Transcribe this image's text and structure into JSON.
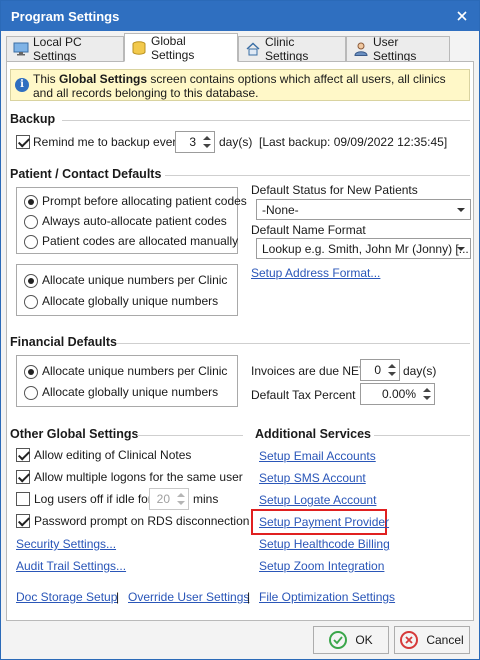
{
  "window": {
    "title": "Program Settings"
  },
  "tabs": [
    {
      "label": "Local PC Settings",
      "icon": "monitor-icon"
    },
    {
      "label": "Global Settings",
      "icon": "database-icon",
      "active": true
    },
    {
      "label": "Clinic Settings",
      "icon": "house-icon"
    },
    {
      "label": "User Settings",
      "icon": "user-icon"
    }
  ],
  "info": {
    "prefix": "This ",
    "bold": "Global Settings",
    "suffix": " screen contains options which affect all users, all clinics and all records belonging to this database."
  },
  "backup": {
    "heading": "Backup",
    "remind_label": "Remind me to backup every",
    "remind_checked": true,
    "days_value": "3",
    "days_unit": "day(s)",
    "last_backup": "[Last backup: 09/09/2022 12:35:45]"
  },
  "patient": {
    "heading": "Patient / Contact Defaults",
    "code_options": [
      {
        "label": "Prompt before allocating patient codes",
        "selected": true
      },
      {
        "label": "Always auto-allocate patient codes",
        "selected": false
      },
      {
        "label": "Patient codes are allocated manually",
        "selected": false
      }
    ],
    "number_options": [
      {
        "label": "Allocate unique numbers per Clinic",
        "selected": true
      },
      {
        "label": "Allocate globally unique numbers",
        "selected": false
      }
    ],
    "default_status_label": "Default Status for New Patients",
    "default_status_value": "-None-",
    "name_format_label": "Default Name Format",
    "name_format_value": "Lookup e.g. Smith, John Mr (Jonny) [...",
    "address_link": "Setup Address Format..."
  },
  "financial": {
    "heading": "Financial Defaults",
    "number_options": [
      {
        "label": "Allocate unique numbers per Clinic",
        "selected": true
      },
      {
        "label": "Allocate globally unique numbers",
        "selected": false
      }
    ],
    "invoices_label": "Invoices are due NET",
    "invoices_value": "0",
    "invoices_unit": "day(s)",
    "tax_label": "Default Tax Percent",
    "tax_value": "0.00%"
  },
  "other": {
    "heading": "Other Global Settings",
    "options": [
      {
        "label": "Allow editing of Clinical Notes",
        "checked": true
      },
      {
        "label": "Allow multiple logons for the same user",
        "checked": true
      },
      {
        "label": "Log users off if idle for",
        "checked": false
      },
      {
        "label": "Password prompt on RDS disconnection",
        "checked": true
      }
    ],
    "idle_value": "20",
    "idle_unit": "mins",
    "security_link": "Security Settings...",
    "audit_link": "Audit Trail Settings..."
  },
  "services": {
    "heading": "Additional Services",
    "links": [
      "Setup Email Accounts",
      "Setup SMS Account",
      "Setup Logate Account",
      "Setup Payment Provider",
      "Setup Healthcode Billing",
      "Setup Zoom Integration"
    ]
  },
  "bottom_links": [
    "Doc Storage Setup",
    "Override User Settings",
    "File Optimization Settings"
  ],
  "buttons": {
    "ok": "OK",
    "cancel": "Cancel"
  },
  "colors": {
    "titlebar": "#2f6fc0",
    "link": "#2a56b8",
    "highlight": "#e02020",
    "ok_icon": "#3aa64a",
    "cancel_icon": "#d63a3a"
  }
}
